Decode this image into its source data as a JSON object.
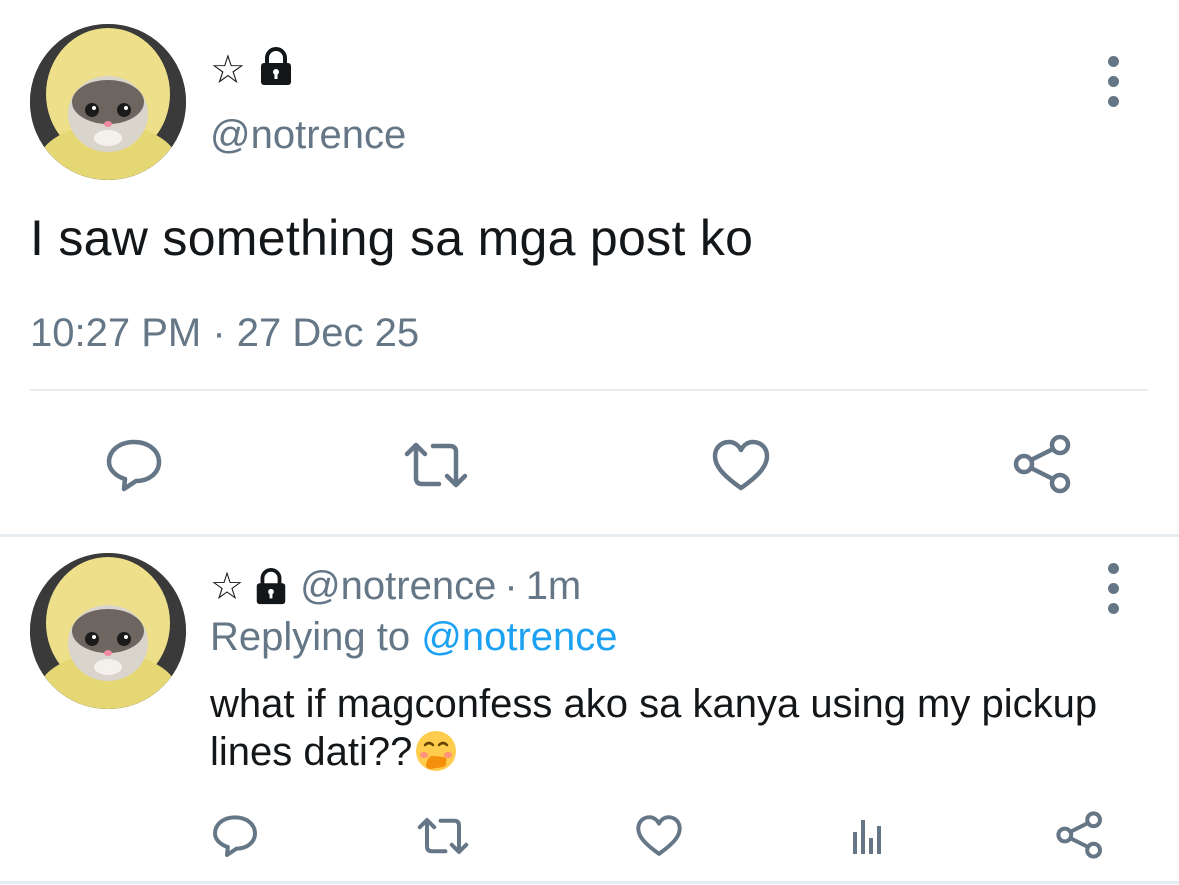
{
  "main_tweet": {
    "display_name_glyph": "☆",
    "handle": "@notrence",
    "text": "I saw something sa mga post ko",
    "time": "10:27 PM",
    "separator": "·",
    "date": "27 Dec 25"
  },
  "reply": {
    "display_name_glyph": "☆",
    "handle": "@notrence",
    "separator": "·",
    "age": "1m",
    "replying_prefix": "Replying to",
    "replying_to": "@notrence",
    "text": "what if magconfess ako sa kanya using my pickup lines dati??",
    "emoji": "face-with-hand-over-mouth"
  },
  "icons": {
    "main_actions": [
      "reply-icon",
      "retweet-icon",
      "like-icon",
      "share-icon"
    ],
    "reply_actions": [
      "reply-icon",
      "retweet-icon",
      "like-icon",
      "analytics-icon",
      "share-icon"
    ]
  },
  "colors": {
    "text": "#14171a",
    "secondary": "#657786",
    "link": "#1da1f2",
    "divider": "#e6ecf0"
  }
}
